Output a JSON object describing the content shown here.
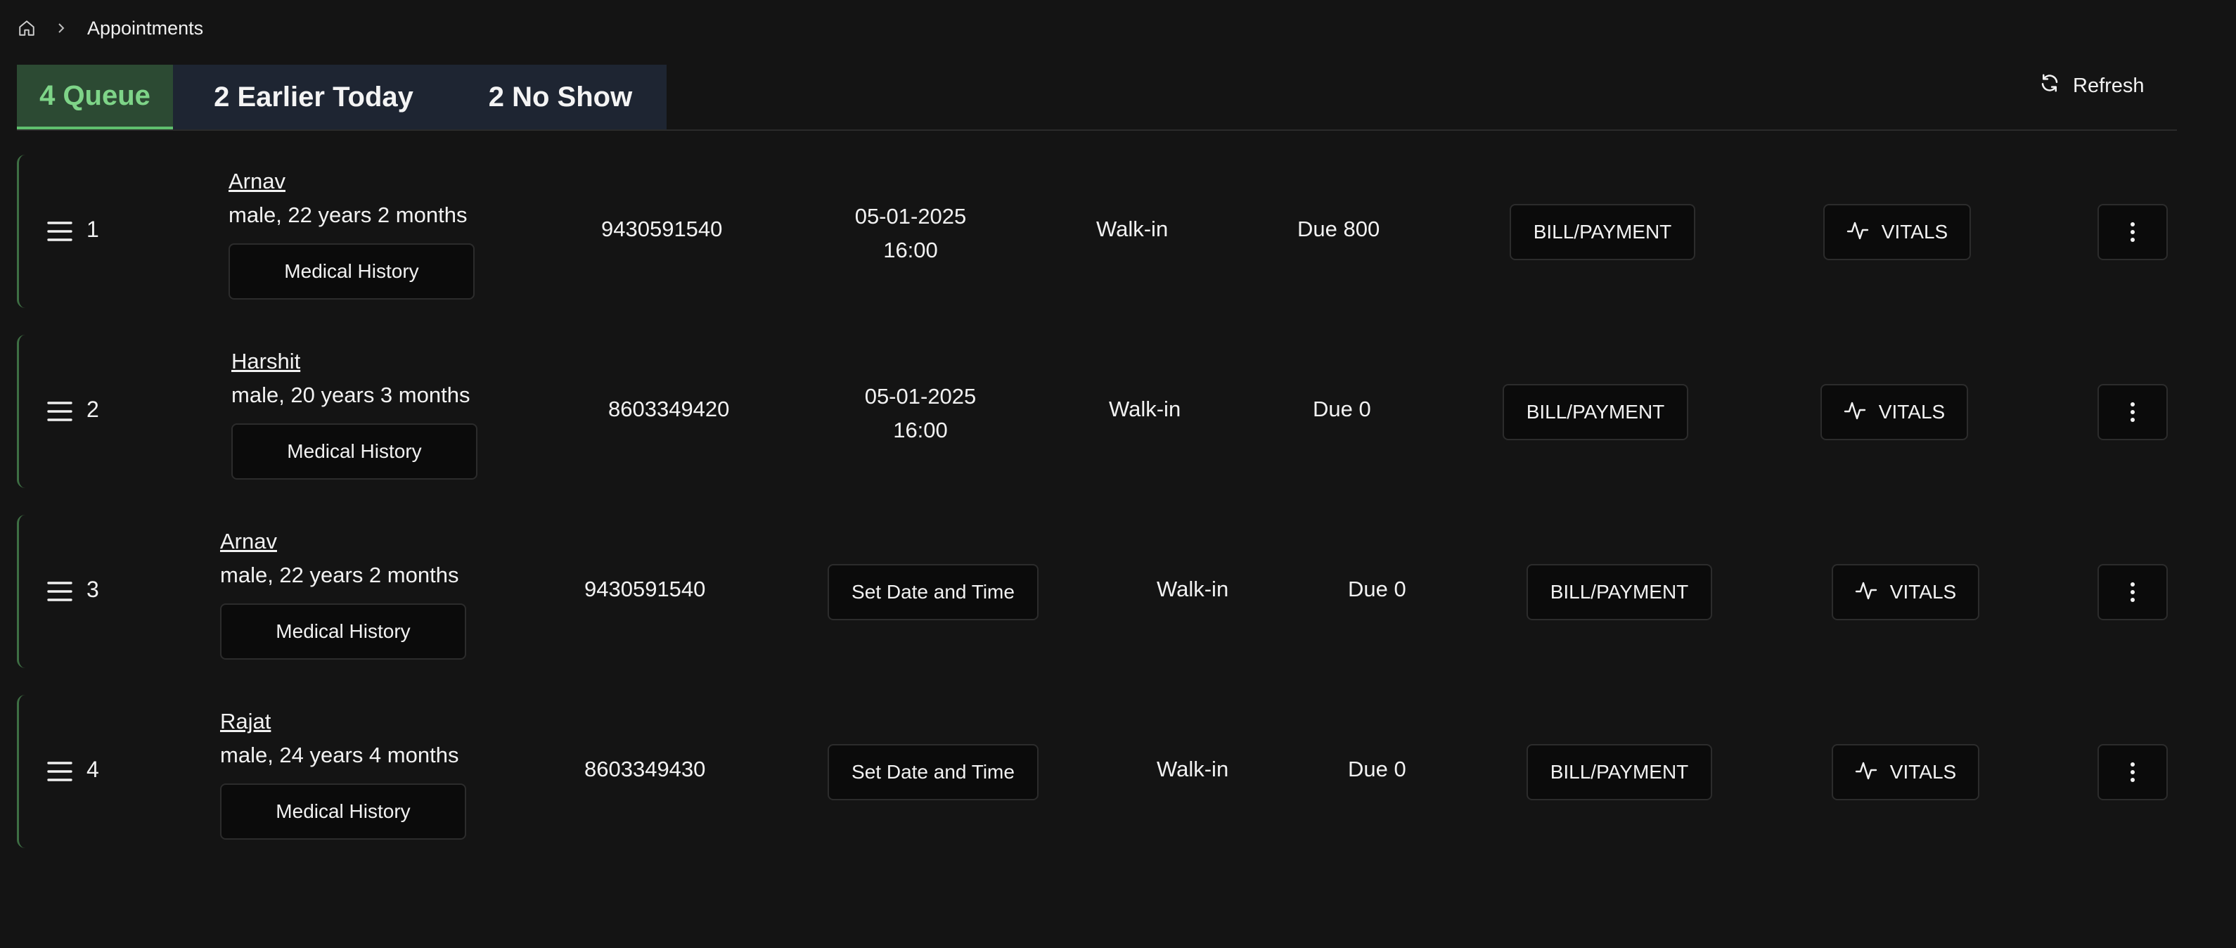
{
  "breadcrumb": {
    "home_icon": "home-icon",
    "separator_icon": "chevron-right-icon",
    "current": "Appointments"
  },
  "tabs": [
    {
      "label": "4 Queue",
      "active": true
    },
    {
      "label": "2 Earlier Today",
      "active": false
    },
    {
      "label": "2 No Show",
      "active": false
    }
  ],
  "refresh": {
    "label": "Refresh",
    "icon": "refresh-icon"
  },
  "colors": {
    "background": "#141414",
    "tab_active_bg": "#2c4a33",
    "tab_active_text": "#7ed488",
    "tab_inactive_bg": "#1e2532",
    "row_accent": "#3e6f44",
    "button_bg": "#0b0b0b"
  },
  "rows": [
    {
      "number": "1",
      "name": "Arnav",
      "details": "male, 22 years 2 months",
      "medical_history": "Medical History",
      "phone": "9430591540",
      "date": "05-01-2025",
      "time": "16:00",
      "type": "Walk-in",
      "due": "Due 800",
      "bill": "BILL/PAYMENT",
      "vitals": "VITALS"
    },
    {
      "number": "2",
      "name": "Harshit",
      "details": "male, 20 years 3 months",
      "medical_history": "Medical History",
      "phone": "8603349420",
      "date": "05-01-2025",
      "time": "16:00",
      "type": "Walk-in",
      "due": "Due 0",
      "bill": "BILL/PAYMENT",
      "vitals": "VITALS"
    },
    {
      "number": "3",
      "name": "Arnav",
      "details": "male, 22 years 2 months",
      "medical_history": "Medical History",
      "phone": "9430591540",
      "set_datetime": "Set Date and Time",
      "type": "Walk-in",
      "due": "Due 0",
      "bill": "BILL/PAYMENT",
      "vitals": "VITALS"
    },
    {
      "number": "4",
      "name": "Rajat",
      "details": "male, 24 years 4 months",
      "medical_history": "Medical History",
      "phone": "8603349430",
      "set_datetime": "Set Date and Time",
      "type": "Walk-in",
      "due": "Due 0",
      "bill": "BILL/PAYMENT",
      "vitals": "VITALS"
    }
  ]
}
